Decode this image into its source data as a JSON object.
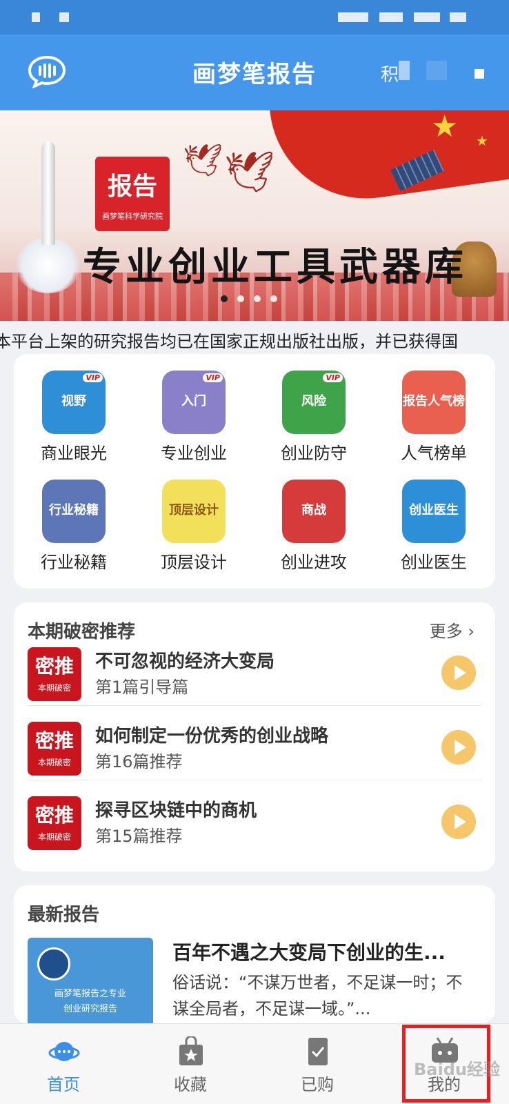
{
  "app": {
    "title": "画梦笔报告",
    "right_text": "积"
  },
  "banner": {
    "logo_main": "报告",
    "logo_sub": "画梦笔科学研究院",
    "headline": "专业创业工具武器库",
    "active_slide": 1,
    "slide_count": 4
  },
  "marquee": {
    "text": "本平台上架的研究报告均已在国家正规出版社出版，并已获得国"
  },
  "categories": [
    {
      "label": "商业眼光",
      "icon": "globe-icon",
      "icon_text": "视野",
      "vip": "VIP",
      "color": "#2f8fd6"
    },
    {
      "label": "专业创业",
      "icon": "door-icon",
      "icon_text": "入门",
      "vip": "VIP",
      "color": "#8a7fc9"
    },
    {
      "label": "创业防守",
      "icon": "risk-icon",
      "icon_text": "风险",
      "vip": "VIP",
      "color": "#3fa34a"
    },
    {
      "label": "人气榜单",
      "icon": "chart-icon",
      "icon_text": "报告人气榜",
      "vip": "",
      "color": "#e9614e"
    },
    {
      "label": "行业秘籍",
      "icon": "book-icon",
      "icon_text": "行业秘籍",
      "vip": "",
      "color": "#5c76b8"
    },
    {
      "label": "顶层设计",
      "icon": "crown-icon",
      "icon_text": "顶层设计",
      "vip": "",
      "color": "#f2e05a"
    },
    {
      "label": "创业进攻",
      "icon": "target-icon",
      "icon_text": "商战",
      "vip": "",
      "color": "#d63b3b"
    },
    {
      "label": "创业医生",
      "icon": "stethoscope-icon",
      "icon_text": "创业医生",
      "vip": "",
      "color": "#2c8fd8"
    }
  ],
  "recommend": {
    "title": "本期破密推荐",
    "more": "更多",
    "thumb_main": "密推",
    "thumb_sub": "本期破密",
    "items": [
      {
        "title": "不可忽视的经济大变局",
        "subtitle": "第1篇引导篇"
      },
      {
        "title": "如何制定一份优秀的创业战略",
        "subtitle": "第16篇推荐"
      },
      {
        "title": "探寻区块链中的商机",
        "subtitle": "第15篇推荐"
      }
    ]
  },
  "latest": {
    "title": "最新报告",
    "thumb_line1": "画梦笔报告之专业",
    "thumb_line2": "创业研究报告",
    "item_title": "百年不遇之大变局下创业的生...",
    "item_body": "俗话说：“不谋万世者，不足谋一时；不谋全局者，不足谋一域。”..."
  },
  "tabs": [
    {
      "label": "首页",
      "icon": "home-planet-icon",
      "active": true
    },
    {
      "label": "收藏",
      "icon": "favorite-bag-icon",
      "active": false
    },
    {
      "label": "已购",
      "icon": "purchased-icon",
      "active": false
    },
    {
      "label": "我的",
      "icon": "profile-icon",
      "active": false
    }
  ],
  "watermark": "Baidu经验",
  "colors": {
    "primary": "#4597ec",
    "tab_active": "#3b8fe6",
    "play": "#f5c76a",
    "highlight": "#ee1c1c"
  }
}
